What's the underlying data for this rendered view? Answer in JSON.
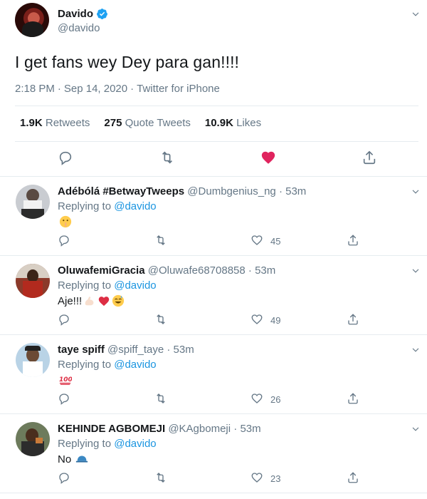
{
  "main_tweet": {
    "name": "Davido",
    "handle": "@davido",
    "verified_icon": "verified-badge-icon",
    "text": "I get fans wey Dey para gan!!!!",
    "time": "2:18 PM",
    "separator": "·",
    "date": "Sep 14, 2020",
    "source": "Twitter for iPhone",
    "stats": [
      {
        "count": "1.9K",
        "label": "Retweets"
      },
      {
        "count": "275",
        "label": "Quote Tweets"
      },
      {
        "count": "10.9K",
        "label": "Likes"
      }
    ],
    "like_color": "#e0245e"
  },
  "replies": [
    {
      "name": "Adébólá #BetwayTweeps",
      "handle": "@Dumbgenius_ng",
      "time": "53m",
      "replying_prefix": "Replying to",
      "replying_to": "@davido",
      "body_text": "",
      "emoji": "shushing-face-emoji",
      "likes": "45"
    },
    {
      "name": "OluwafemiGracia",
      "handle": "@Oluwafe68708858",
      "time": "53m",
      "replying_prefix": "Replying to",
      "replying_to": "@davido",
      "body_text": "Aje!!!",
      "emoji": "flexed-biceps-heart-sweat-smile-emoji",
      "likes": "49"
    },
    {
      "name": "taye spiff",
      "handle": "@spiff_taye",
      "time": "53m",
      "replying_prefix": "Replying to",
      "replying_to": "@davido",
      "body_text": "",
      "emoji": "hundred-points-emoji",
      "likes": "26"
    },
    {
      "name": "KEHINDE AGBOMEJI",
      "handle": "@KAgbomeji",
      "time": "53m",
      "replying_prefix": "Replying to",
      "replying_to": "@davido",
      "body_text": "No",
      "emoji": "cap-emoji",
      "likes": "23"
    }
  ],
  "colors": {
    "link": "#1b95e0",
    "muted": "#657786",
    "divider": "#e6ecf0",
    "verified": "#1da1f2"
  }
}
